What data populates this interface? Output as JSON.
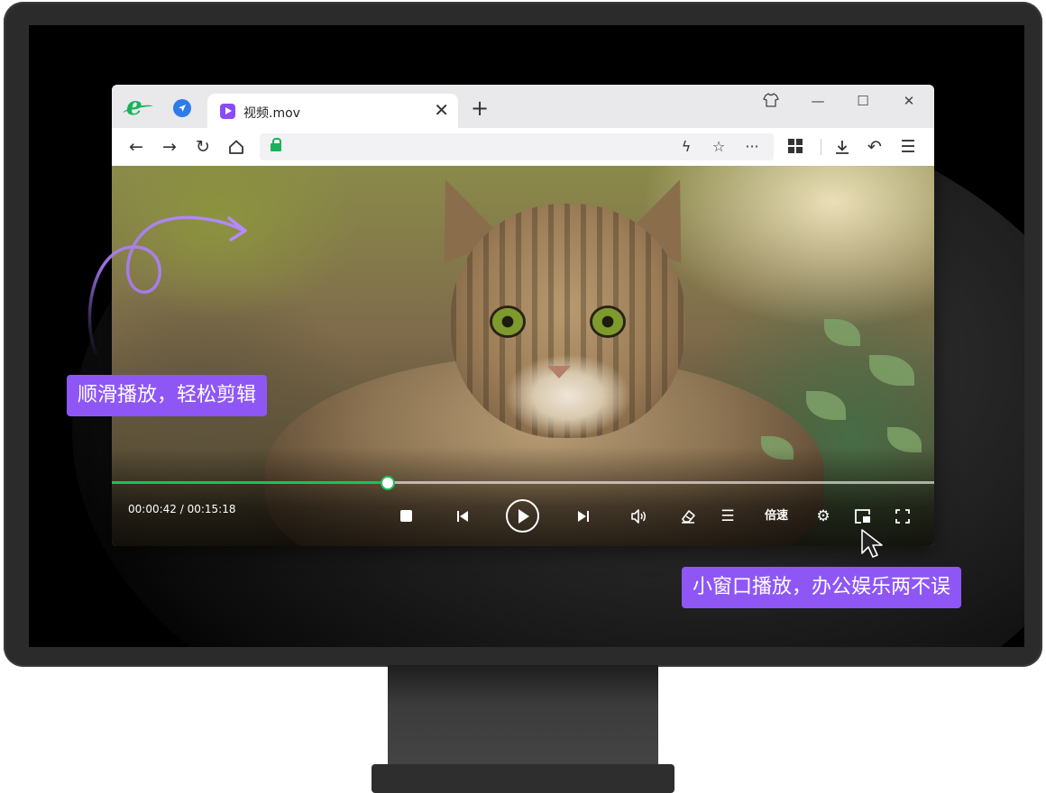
{
  "browser": {
    "tab": {
      "title": "视频.mov"
    },
    "window_controls": [
      "skin",
      "minimize",
      "maximize",
      "close"
    ],
    "nav_icons": [
      "back-icon",
      "forward-icon",
      "reload-icon",
      "home-icon"
    ],
    "url_tools": [
      "lightning-icon",
      "star-icon",
      "more-icon"
    ],
    "toolbar_icons": [
      "apps-grid-icon",
      "download-icon",
      "undo-icon",
      "menu-icon"
    ]
  },
  "player": {
    "time": "00:00:42 / 00:15:18",
    "progress": 0.336,
    "speed_label": "倍速",
    "accent_color": "#1fbf5a"
  },
  "annotations": {
    "smooth": "顺滑播放，轻松剪辑",
    "pip": "小窗口播放，办公娱乐两不误"
  },
  "colors": {
    "callout": "#8e57f5",
    "arrow": "#a77bf7",
    "logo": "#17b35a"
  }
}
